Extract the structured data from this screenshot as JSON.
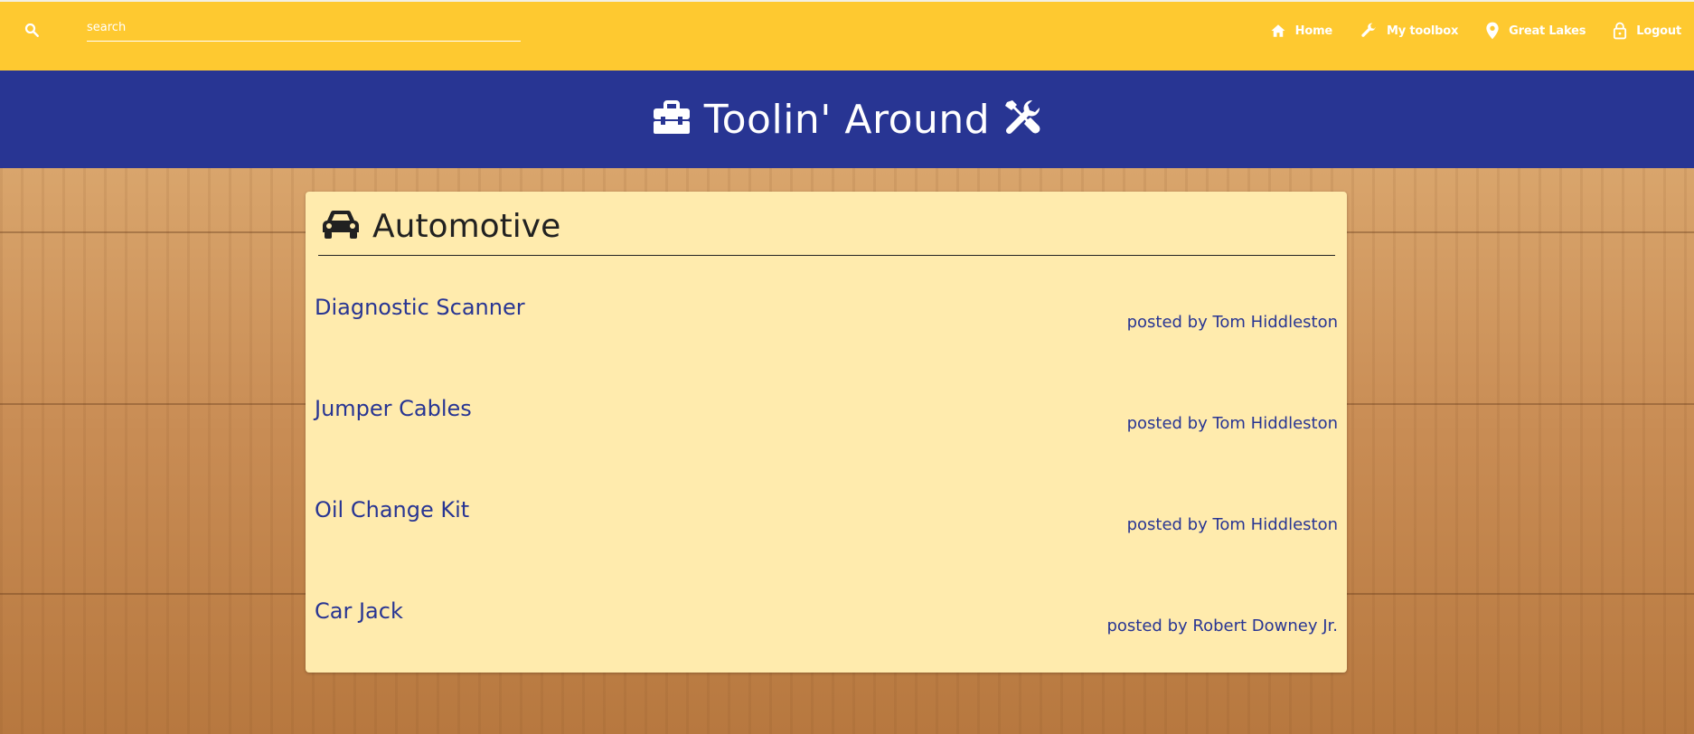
{
  "colors": {
    "nav_bg": "#fec930",
    "banner_bg": "#283593",
    "card_bg": "#ffebad",
    "link": "#283593",
    "text_dark": "#212121"
  },
  "search": {
    "placeholder": "search",
    "icon": "search-icon"
  },
  "nav": [
    {
      "label": "Home",
      "icon": "home-icon"
    },
    {
      "label": "My toolbox",
      "icon": "wrench-icon"
    },
    {
      "label": "Great Lakes",
      "icon": "location-pin-icon"
    },
    {
      "label": "Logout",
      "icon": "lock-icon"
    }
  ],
  "banner": {
    "title": "Toolin' Around",
    "left_icon": "toolbox-icon",
    "right_icon": "tools-icon"
  },
  "category": {
    "title": "Automotive",
    "icon": "car-icon"
  },
  "tools": [
    {
      "name": "Diagnostic Scanner",
      "posted_by": "posted by Tom Hiddleston"
    },
    {
      "name": "Jumper Cables",
      "posted_by": "posted by Tom Hiddleston"
    },
    {
      "name": "Oil Change Kit",
      "posted_by": "posted by Tom Hiddleston"
    },
    {
      "name": "Car Jack",
      "posted_by": "posted by Robert Downey Jr."
    }
  ]
}
